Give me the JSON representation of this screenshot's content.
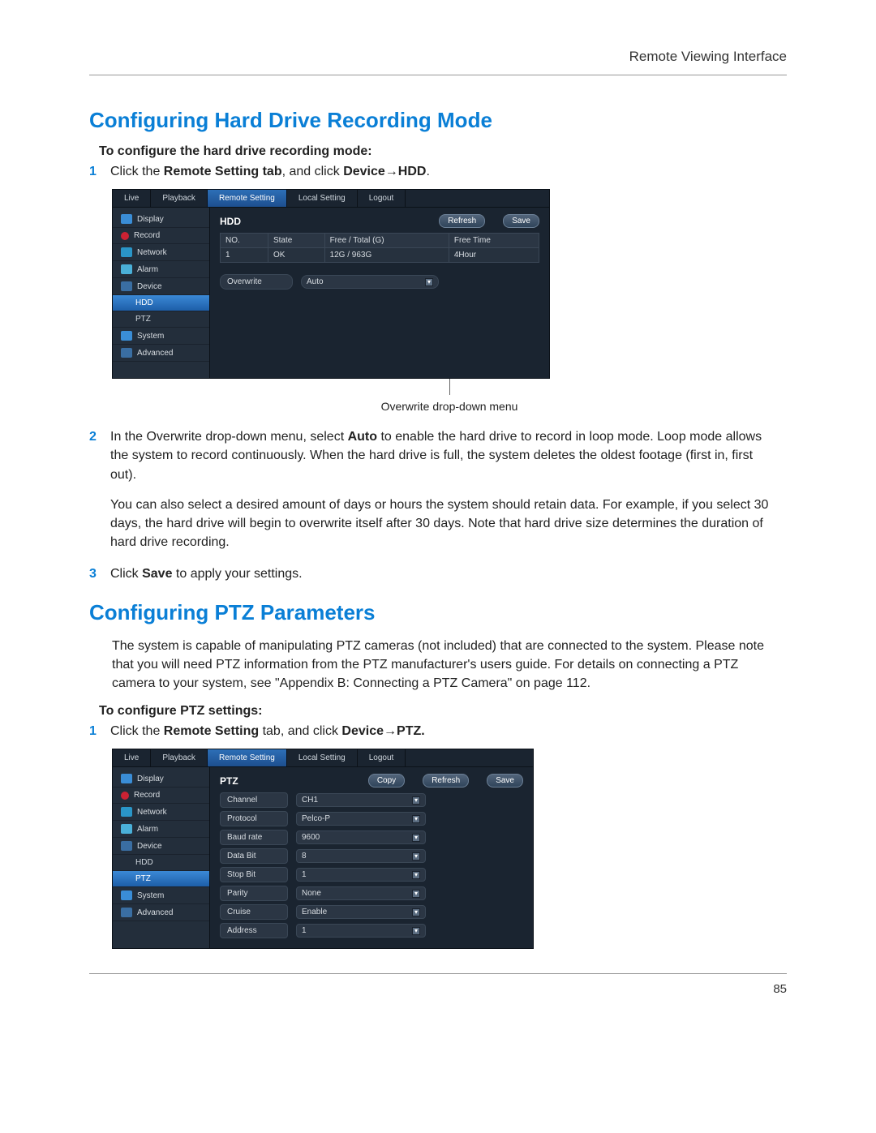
{
  "header": {
    "section": "Remote Viewing Interface"
  },
  "h1": "Configuring Hard Drive Recording Mode",
  "sub1": "To configure the hard drive recording mode:",
  "step1": {
    "num": "1",
    "pre": "Click the ",
    "b1": "Remote Setting tab",
    "mid": ", and click ",
    "b2": "Device",
    "arrow": "→",
    "b3": "HDD",
    "post": "."
  },
  "caption1": "Overwrite drop-down menu",
  "step2": {
    "num": "2",
    "line_pre": "In the Overwrite drop-down menu, select ",
    "auto": "Auto",
    "line_post": " to enable the hard drive to record in loop mode. Loop mode allows the system to record continuously. When the hard drive is full, the system deletes the oldest footage (first in, first out).",
    "para2": "You can also select a desired amount of days or hours the system should retain data. For example, if you select 30 days, the hard drive will begin to overwrite itself after 30 days. Note that hard drive size determines the duration of hard drive recording."
  },
  "step3": {
    "num": "3",
    "pre": "Click ",
    "b": "Save",
    "post": " to apply your settings."
  },
  "h2": "Configuring PTZ Parameters",
  "ptz_intro": "The system is capable of manipulating PTZ cameras (not included) that are connected to the system. Please note that you will need PTZ information from the PTZ manufacturer's users guide. For details on connecting a PTZ camera to your system, see \"Appendix B: Connecting a PTZ Camera\" on page 112.",
  "sub2": "To configure PTZ settings:",
  "stepP1": {
    "num": "1",
    "pre": "Click the ",
    "b1": "Remote Setting",
    "mid": " tab, and click ",
    "b2": "Device",
    "arrow": "→",
    "b3": "PTZ.",
    "post": ""
  },
  "pagenum": "85",
  "ui_tabs": {
    "live": "Live",
    "playback": "Playback",
    "remote": "Remote Setting",
    "local": "Local Setting",
    "logout": "Logout"
  },
  "sidebar": {
    "display": "Display",
    "record": "Record",
    "network": "Network",
    "alarm": "Alarm",
    "device": "Device",
    "hdd": "HDD",
    "ptz": "PTZ",
    "system": "System",
    "advanced": "Advanced"
  },
  "hdd_panel": {
    "title": "HDD",
    "refresh": "Refresh",
    "save": "Save",
    "col_no": "NO.",
    "col_state": "State",
    "col_free": "Free / Total (G)",
    "col_time": "Free Time",
    "row_no": "1",
    "row_state": "OK",
    "row_free": "12G / 963G",
    "row_time": "4Hour",
    "overwrite_label": "Overwrite",
    "overwrite_value": "Auto"
  },
  "ptz_panel": {
    "title": "PTZ",
    "copy": "Copy",
    "refresh": "Refresh",
    "save": "Save",
    "fields": [
      {
        "label": "Channel",
        "value": "CH1"
      },
      {
        "label": "Protocol",
        "value": "Pelco-P"
      },
      {
        "label": "Baud rate",
        "value": "9600"
      },
      {
        "label": "Data Bit",
        "value": "8"
      },
      {
        "label": "Stop Bit",
        "value": "1"
      },
      {
        "label": "Parity",
        "value": "None"
      },
      {
        "label": "Cruise",
        "value": "Enable"
      },
      {
        "label": "Address",
        "value": "1"
      }
    ]
  }
}
